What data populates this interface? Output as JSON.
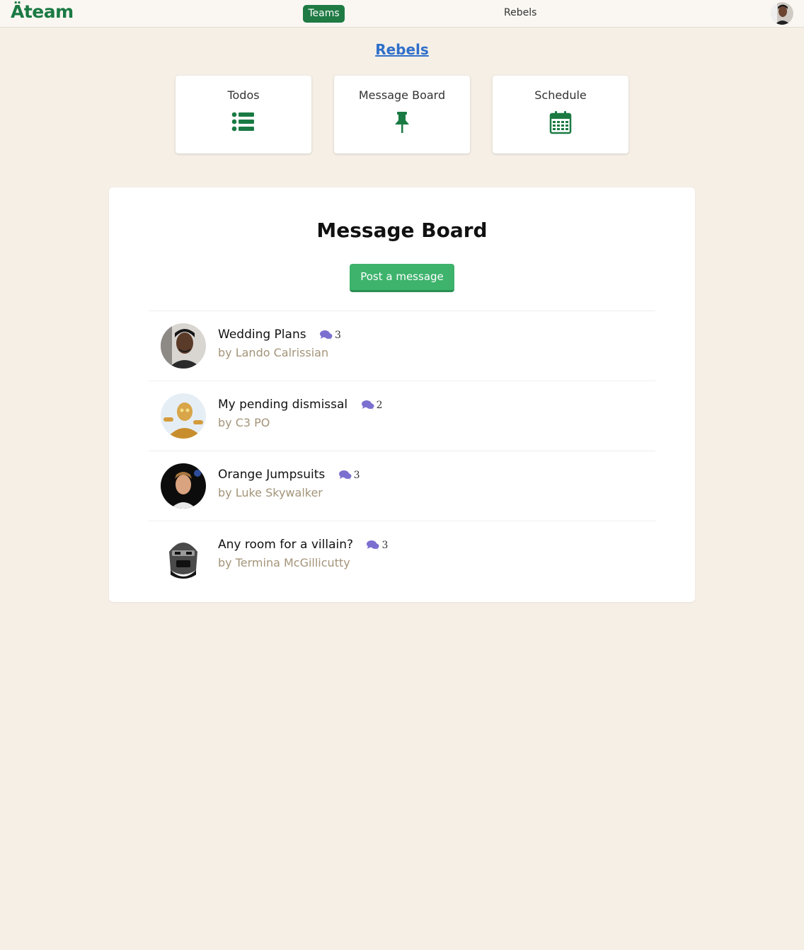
{
  "nav": {
    "logo": "Äteam",
    "teams_label": "Teams",
    "team_name": "Rebels"
  },
  "team_title": "Rebels",
  "tools": [
    {
      "label": "Todos",
      "icon": "list-icon"
    },
    {
      "label": "Message Board",
      "icon": "pin-icon"
    },
    {
      "label": "Schedule",
      "icon": "calendar-icon"
    }
  ],
  "board": {
    "title": "Message Board",
    "post_label": "Post a message",
    "messages": [
      {
        "title": "Wedding Plans",
        "comments": "3",
        "author": "by Lando Calrissian"
      },
      {
        "title": "My pending dismissal",
        "comments": "2",
        "author": "by C3 PO"
      },
      {
        "title": "Orange Jumpsuits",
        "comments": "3",
        "author": "by Luke Skywalker"
      },
      {
        "title": "Any room for a villain?",
        "comments": "3",
        "author": "by Termina McGillicutty"
      }
    ]
  },
  "colors": {
    "brand_green": "#1a7a43",
    "button_green": "#3db36c",
    "link_blue": "#2f6fca",
    "comment_icon": "#7b6fd0",
    "author_text": "#a39479",
    "background": "#f5efe6"
  }
}
